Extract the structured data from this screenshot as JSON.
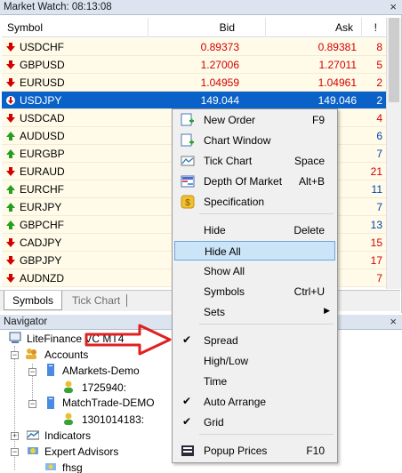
{
  "market_watch": {
    "title": "Market Watch: 08:13:08",
    "columns": {
      "symbol": "Symbol",
      "bid": "Bid",
      "ask": "Ask",
      "spread": "!"
    },
    "rows": [
      {
        "symbol": "USDCHF",
        "dir": "down",
        "bid": "0.89373",
        "ask": "0.89381",
        "spread": "8"
      },
      {
        "symbol": "GBPUSD",
        "dir": "down",
        "bid": "1.27006",
        "ask": "1.27011",
        "spread": "5"
      },
      {
        "symbol": "EURUSD",
        "dir": "down",
        "bid": "1.04959",
        "ask": "1.04961",
        "spread": "2"
      },
      {
        "symbol": "USDJPY",
        "dir": "down",
        "bid": "149.044",
        "ask": "149.046",
        "spread": "2"
      },
      {
        "symbol": "USDCAD",
        "dir": "down",
        "bid": "",
        "ask": "",
        "spread": "4"
      },
      {
        "symbol": "AUDUSD",
        "dir": "up",
        "bid": "",
        "ask": "",
        "spread": "6"
      },
      {
        "symbol": "EURGBP",
        "dir": "up",
        "bid": "",
        "ask": "",
        "spread": "7"
      },
      {
        "symbol": "EURAUD",
        "dir": "down",
        "bid": "",
        "ask": "",
        "spread": "21"
      },
      {
        "symbol": "EURCHF",
        "dir": "up",
        "bid": "",
        "ask": "",
        "spread": "11"
      },
      {
        "symbol": "EURJPY",
        "dir": "up",
        "bid": "",
        "ask": "",
        "spread": "7"
      },
      {
        "symbol": "GBPCHF",
        "dir": "up",
        "bid": "",
        "ask": "",
        "spread": "13"
      },
      {
        "symbol": "CADJPY",
        "dir": "down",
        "bid": "",
        "ask": "",
        "spread": "15"
      },
      {
        "symbol": "GBPJPY",
        "dir": "down",
        "bid": "",
        "ask": "",
        "spread": "17"
      },
      {
        "symbol": "AUDNZD",
        "dir": "down",
        "bid": "",
        "ask": "",
        "spread": "7"
      }
    ],
    "tabs": [
      "Symbols",
      "Tick Chart"
    ]
  },
  "navigator": {
    "title": "Navigator",
    "root": "LiteFinance VC MT4",
    "accounts_label": "Accounts",
    "account1": "AMarkets-Demo",
    "account1_id": "1725940:",
    "account2": "MatchTrade-DEMO",
    "account2_id": "1301014183:",
    "indicators": "Indicators",
    "experts": "Expert Advisors",
    "ea1": "fhsg"
  },
  "context_menu": {
    "items": [
      {
        "label": "New Order",
        "key": "F9"
      },
      {
        "label": "Chart Window",
        "key": ""
      },
      {
        "label": "Tick Chart",
        "key": "Space"
      },
      {
        "label": "Depth Of Market",
        "key": "Alt+B"
      },
      {
        "label": "Specification",
        "key": ""
      },
      {
        "label": "Hide",
        "key": "Delete"
      },
      {
        "label": "Hide All",
        "key": ""
      },
      {
        "label": "Show All",
        "key": ""
      },
      {
        "label": "Symbols",
        "key": "Ctrl+U"
      },
      {
        "label": "Sets",
        "key": ""
      },
      {
        "label": "Spread",
        "key": ""
      },
      {
        "label": "High/Low",
        "key": ""
      },
      {
        "label": "Time",
        "key": ""
      },
      {
        "label": "Auto Arrange",
        "key": ""
      },
      {
        "label": "Grid",
        "key": ""
      },
      {
        "label": "Popup Prices",
        "key": "F10"
      }
    ]
  },
  "colors": {
    "selected_row": "#0a62c8",
    "row_bg": "#fffbe8",
    "down": "#d20000",
    "up": "#22a022",
    "menu_highlight": "#cce4f7"
  },
  "icons": {
    "close": "close-icon",
    "up": "up-arrow-icon",
    "down": "down-arrow-icon"
  }
}
